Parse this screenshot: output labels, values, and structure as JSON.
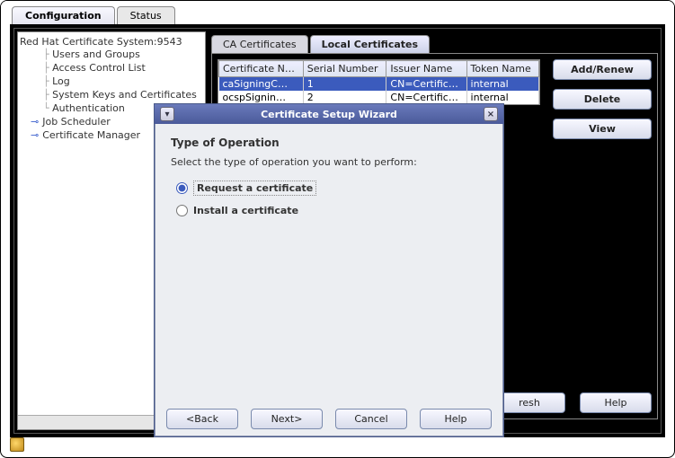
{
  "outer_tabs": {
    "configuration": "Configuration",
    "status": "Status"
  },
  "tree": {
    "root": "Red Hat Certificate System:9543",
    "items": [
      "Users and Groups",
      "Access Control List",
      "Log",
      "System Keys and Certificates",
      "Authentication",
      "Job Scheduler",
      "Certificate Manager"
    ]
  },
  "inner_tabs": {
    "ca": "CA Certificates",
    "local": "Local Certificates"
  },
  "table": {
    "headers": {
      "name": "Certificate N…",
      "serial": "Serial Number",
      "issuer": "Issuer Name",
      "token": "Token Name"
    },
    "rows": [
      {
        "name": "caSigningC…",
        "serial": "1",
        "issuer": "CN=Certific…",
        "token": "internal"
      },
      {
        "name": "ocspSignin…",
        "serial": "2",
        "issuer": "CN=Certific…",
        "token": "internal"
      }
    ]
  },
  "buttons": {
    "add_renew": "Add/Renew",
    "delete": "Delete",
    "view": "View",
    "refresh": "resh",
    "help": "Help"
  },
  "wizard": {
    "title": "Certificate Setup Wizard",
    "heading": "Type of Operation",
    "prompt": "Select the type of operation you want to perform:",
    "opt_request": "Request a certificate",
    "opt_install": "Install a certificate",
    "back": "<Back",
    "next": "Next>",
    "cancel": "Cancel",
    "help": "Help"
  }
}
